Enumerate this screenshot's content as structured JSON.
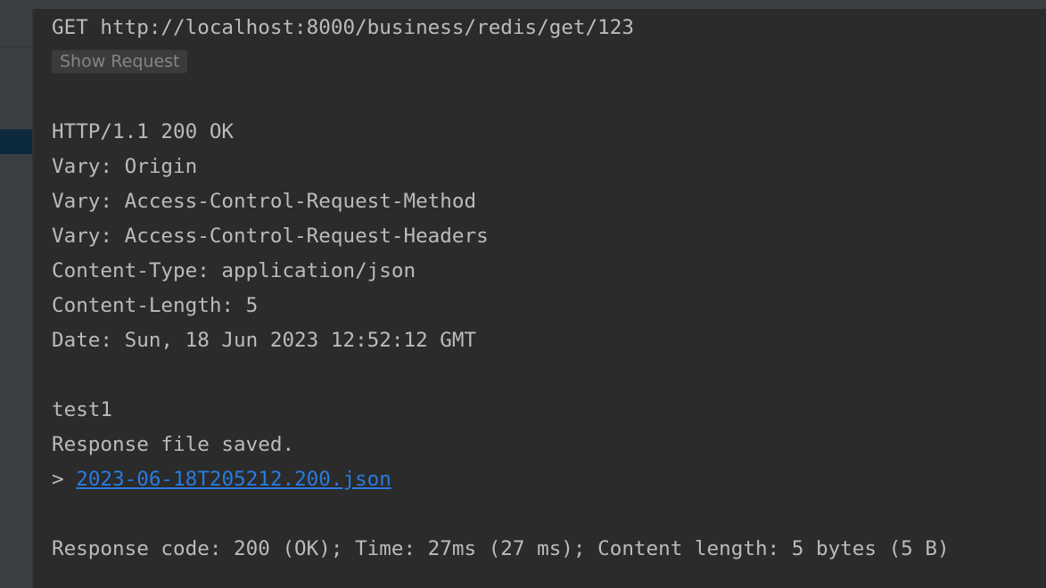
{
  "request": {
    "line": "GET http://localhost:8000/business/redis/get/123",
    "show_request_label": "Show Request"
  },
  "response": {
    "status": "HTTP/1.1 200 OK",
    "headers": [
      "Vary: Origin",
      "Vary: Access-Control-Request-Method",
      "Vary: Access-Control-Request-Headers",
      "Content-Type: application/json",
      "Content-Length: 5",
      "Date: Sun, 18 Jun 2023 12:52:12 GMT"
    ],
    "body": "test1",
    "saved_message": "Response file saved.",
    "file_prefix": "> ",
    "file_link": "2023-06-18T205212.200.json",
    "summary": "Response code: 200 (OK); Time: 27ms (27 ms); Content length: 5 bytes (5 B)"
  },
  "colors": {
    "background": "#2b2b2b",
    "text": "#bbbbbb",
    "link": "#287bde",
    "side_panel": "#3c3f41",
    "selected_row": "#0d293e"
  }
}
